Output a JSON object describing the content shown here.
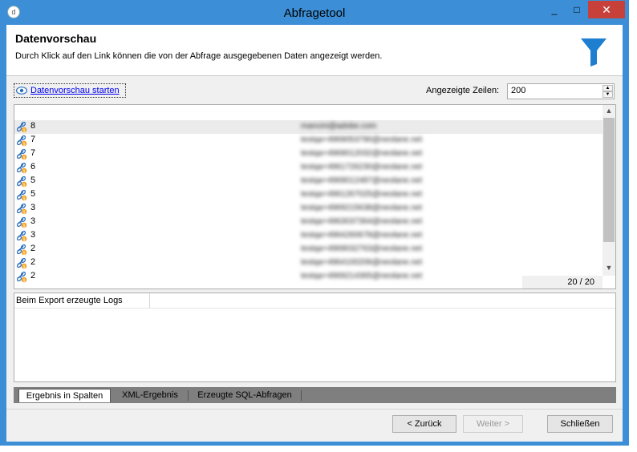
{
  "window": {
    "title": "Abfragetool",
    "minimize": "_",
    "maximize": "□",
    "close": "✕"
  },
  "header": {
    "title": "Datenvorschau",
    "description": "Durch Klick auf den Link können die von der Abfrage ausgegebenen Daten angezeigt werden.",
    "icon": "funnel-icon"
  },
  "toolbar": {
    "start_link": "Datenvorschau starten",
    "rows_label": "Angezeigte Zeilen:",
    "rows_value": "200"
  },
  "preview": {
    "rows": [
      {
        "count": "8",
        "email": "mancini@adobe.com"
      },
      {
        "count": "7",
        "email": "testqa+4969053790@neolane.net"
      },
      {
        "count": "7",
        "email": "testqa+4969012032@neolane.net"
      },
      {
        "count": "6",
        "email": "testqa+4961726230@neolane.net"
      },
      {
        "count": "5",
        "email": "testqa+4969012487@neolane.net"
      },
      {
        "count": "5",
        "email": "testqa+4961267025@neolane.net"
      },
      {
        "count": "3",
        "email": "testqa+4969215638@neolane.net"
      },
      {
        "count": "3",
        "email": "testqa+4963037364@neolane.net"
      },
      {
        "count": "3",
        "email": "testqa+4964260678@neolane.net"
      },
      {
        "count": "2",
        "email": "testqa+4969032763@neolane.net"
      },
      {
        "count": "2",
        "email": "testqa+4964100206@neolane.net"
      },
      {
        "count": "2",
        "email": "testqa+4969214365@neolane.net"
      }
    ],
    "counter": "20 / 20"
  },
  "logs": {
    "title": "Beim Export erzeugte Logs"
  },
  "tabs": [
    {
      "label": "Ergebnis in Spalten"
    },
    {
      "label": "XML-Ergebnis"
    },
    {
      "label": "Erzeugte SQL-Abfragen"
    }
  ],
  "buttons": {
    "back": "< Zurück",
    "next": "Weiter >",
    "close": "Schließen"
  },
  "colors": {
    "titlebar": "#3c8fd6",
    "close": "#c7413a",
    "link": "#0000ee",
    "funnel": "#1e7fd0"
  }
}
